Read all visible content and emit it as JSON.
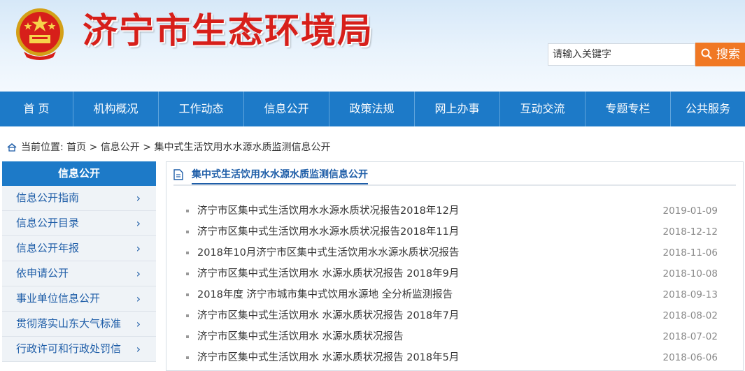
{
  "header": {
    "site_title": "济宁市生态环境局",
    "search_placeholder": "请输入关键字",
    "search_button": "搜索",
    "emblem_icon": "national-emblem-icon",
    "search_icon": "search-icon"
  },
  "nav": {
    "items": [
      "首 页",
      "机构概况",
      "工作动态",
      "信息公开",
      "政策法规",
      "网上办事",
      "互动交流",
      "专题专栏",
      "公共服务"
    ]
  },
  "breadcrumb": {
    "label": "当前位置:",
    "path": [
      "首页",
      "信息公开",
      "集中式生活饮用水水源水质监测信息公开"
    ],
    "separator": ">"
  },
  "sidebar": {
    "title": "信息公开",
    "items": [
      "信息公开指南",
      "信息公开目录",
      "信息公开年报",
      "依申请公开",
      "事业单位信息公开",
      "贯彻落实山东大气标准",
      "行政许可和行政处罚信"
    ]
  },
  "main": {
    "title": "集中式生活饮用水水源水质监测信息公开",
    "articles": [
      {
        "title": "济宁市区集中式生活饮用水水源水质状况报告2018年12月",
        "date": "2019-01-09"
      },
      {
        "title": "济宁市区集中式生活饮用水水源水质状况报告2018年11月",
        "date": "2018-12-12"
      },
      {
        "title": "2018年10月济宁市区集中式生活饮用水水源水质状况报告",
        "date": "2018-11-06"
      },
      {
        "title": "济宁市区集中式生活饮用水 水源水质状况报告 2018年9月",
        "date": "2018-10-08"
      },
      {
        "title": "2018年度 济宁市城市集中式饮用水源地 全分析监测报告",
        "date": "2018-09-13"
      },
      {
        "title": "济宁市区集中式生活饮用水 水源水质状况报告 2018年7月",
        "date": "2018-08-02"
      },
      {
        "title": "济宁市区集中式生活饮用水 水源水质状况报告",
        "date": "2018-07-02"
      },
      {
        "title": "济宁市区集中式生活饮用水 水源水质状况报告 2018年5月",
        "date": "2018-06-06"
      }
    ]
  },
  "colors": {
    "nav_blue": "#1d7ac8",
    "title_red": "#d71f1a",
    "search_orange": "#f07824",
    "link_blue": "#1f5ea8"
  }
}
